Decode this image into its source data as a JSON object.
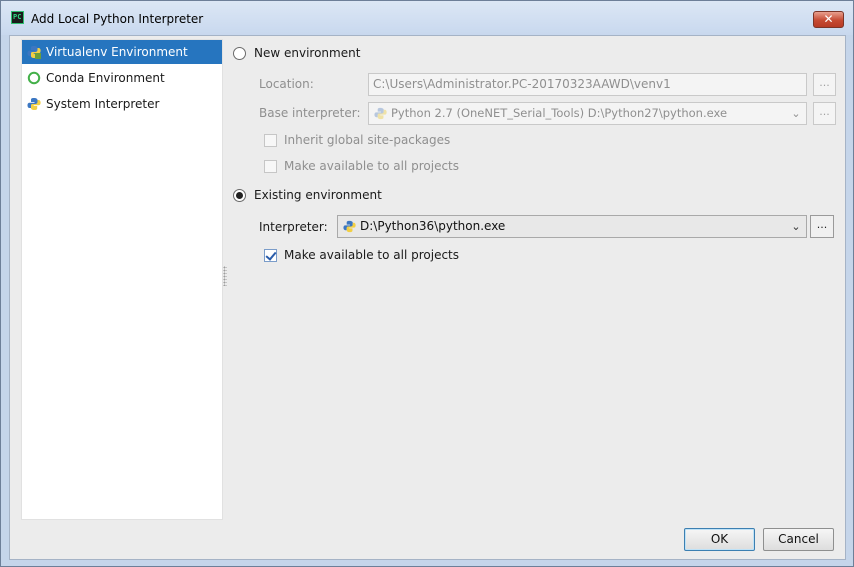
{
  "window": {
    "title": "Add Local Python Interpreter",
    "app_icon_text": "PC",
    "close_glyph": "✕"
  },
  "sidebar": {
    "items": [
      {
        "label": "Virtualenv Environment",
        "icon": "virtualenv-icon",
        "selected": true
      },
      {
        "label": "Conda Environment",
        "icon": "conda-icon",
        "selected": false
      },
      {
        "label": "System Interpreter",
        "icon": "python-icon",
        "selected": false
      }
    ]
  },
  "new_env": {
    "radio_label": "New environment",
    "selected": false,
    "location_label": "Location:",
    "location_value": "C:\\Users\\Administrator.PC-20170323AAWD\\venv1",
    "base_label": "Base interpreter:",
    "base_value": "Python 2.7 (OneNET_Serial_Tools) D:\\Python27\\python.exe",
    "inherit_label": "Inherit global site-packages",
    "inherit_checked": false,
    "make_available_label": "Make available to all projects",
    "make_available_checked": false,
    "browse_glyph": "..."
  },
  "existing_env": {
    "radio_label": "Existing environment",
    "selected": true,
    "interpreter_label": "Interpreter:",
    "interpreter_value": "D:\\Python36\\python.exe",
    "make_available_label": "Make available to all projects",
    "make_available_checked": true,
    "browse_glyph": "..."
  },
  "buttons": {
    "ok": "OK",
    "cancel": "Cancel"
  },
  "colors": {
    "selection": "#2675bf",
    "frame": "#c5d5ea",
    "panel": "#ececec"
  }
}
